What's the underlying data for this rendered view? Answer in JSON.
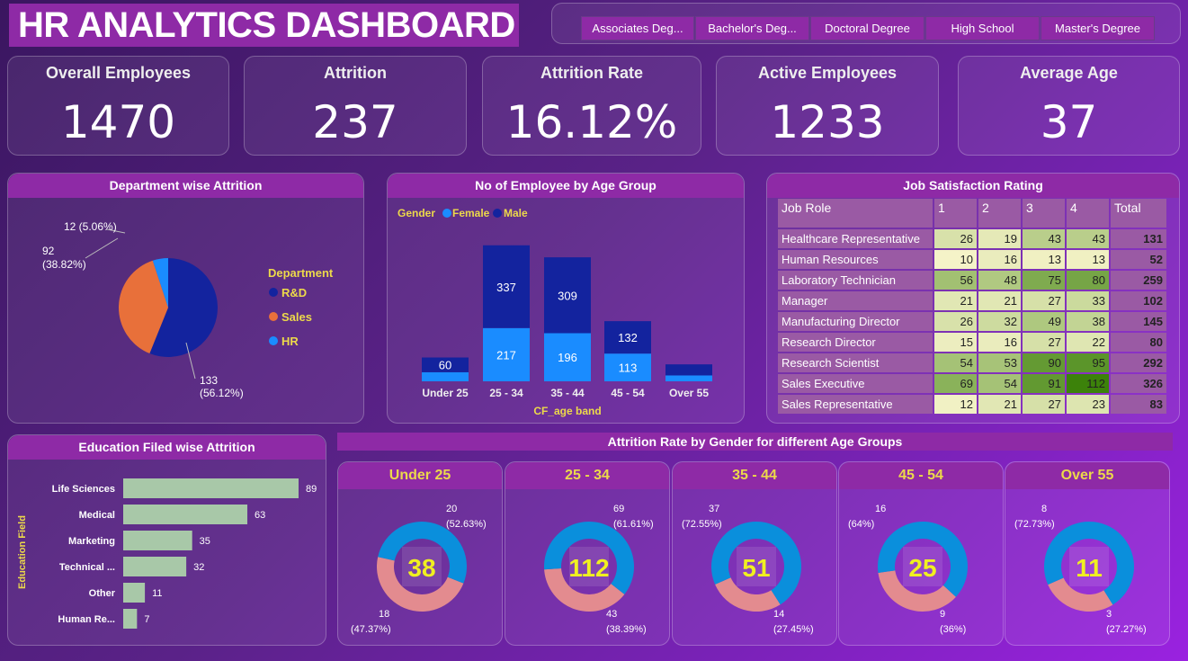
{
  "header": {
    "title": "HR ANALYTICS DASHBOARD"
  },
  "slicer": {
    "options": [
      "Associates Deg...",
      "Bachelor's Deg...",
      "Doctoral Degree",
      "High School",
      "Master's Degree"
    ]
  },
  "kpis": [
    {
      "label": "Overall Employees",
      "value": "1470"
    },
    {
      "label": "Attrition",
      "value": "237"
    },
    {
      "label": "Attrition Rate",
      "value": "16.12%"
    },
    {
      "label": "Active Employees",
      "value": "1233"
    },
    {
      "label": "Average Age",
      "value": "37"
    }
  ],
  "colors": {
    "title_bg": "#8e2aa6",
    "accent_yellow": "#ecd94a",
    "male": "#13239e",
    "female": "#1a8cff",
    "donut_a": "#0a8fdc",
    "donut_b": "#e38b8f",
    "edu_bar": "#a8c8a8"
  },
  "chart_data": [
    {
      "type": "pie",
      "title": "Department wise Attrition",
      "legend_title": "Department",
      "legend_position": "right",
      "slices": [
        {
          "name": "R&D",
          "value": 133,
          "label": "133\n(56.12%)",
          "color": "#13239e"
        },
        {
          "name": "Sales",
          "value": 92,
          "label": "92\n(38.82%)",
          "color": "#e8703a"
        },
        {
          "name": "HR",
          "value": 12,
          "label": "12 (5.06%)",
          "color": "#1a8cff"
        }
      ]
    },
    {
      "type": "bar",
      "stacked": true,
      "title": "No of Employee by Age Group",
      "legend_title": "Gender",
      "legend_position": "top-left",
      "xlabel": "CF_age band",
      "categories": [
        "Under 25",
        "25 - 34",
        "35 - 44",
        "45 - 54",
        "Over 55"
      ],
      "series": [
        {
          "name": "Female",
          "values": [
            37,
            217,
            196,
            113,
            24
          ],
          "labels": [
            "",
            "217",
            "196",
            "113",
            ""
          ]
        },
        {
          "name": "Male",
          "values": [
            60,
            337,
            309,
            132,
            45
          ],
          "labels": [
            "60",
            "337",
            "309",
            "132",
            ""
          ]
        }
      ]
    },
    {
      "type": "table",
      "title": "Job Satisfaction Rating",
      "columns": [
        "Job Role",
        "1",
        "2",
        "3",
        "4",
        "Total"
      ],
      "rows": [
        [
          "Healthcare Representative",
          26,
          19,
          43,
          43,
          131
        ],
        [
          "Human Resources",
          10,
          16,
          13,
          13,
          52
        ],
        [
          "Laboratory Technician",
          56,
          48,
          75,
          80,
          259
        ],
        [
          "Manager",
          21,
          21,
          27,
          33,
          102
        ],
        [
          "Manufacturing Director",
          26,
          32,
          49,
          38,
          145
        ],
        [
          "Research Director",
          15,
          16,
          27,
          22,
          80
        ],
        [
          "Research Scientist",
          54,
          53,
          90,
          95,
          292
        ],
        [
          "Sales Executive",
          69,
          54,
          91,
          112,
          326
        ],
        [
          "Sales Representative",
          12,
          21,
          27,
          23,
          83
        ]
      ]
    },
    {
      "type": "bar",
      "orientation": "horizontal",
      "title": "Education Filed wise Attrition",
      "ylabel": "Education Field",
      "categories": [
        "Life Sciences",
        "Medical",
        "Marketing",
        "Technical ...",
        "Other",
        "Human Re..."
      ],
      "values": [
        89,
        63,
        35,
        32,
        11,
        7
      ]
    },
    {
      "type": "pie",
      "donut": true,
      "title": "Attrition Rate by Gender for different Age Groups",
      "groups": [
        {
          "name": "Under 25",
          "total": "38",
          "slices": [
            {
              "value": 20,
              "label": [
                "20",
                "(52.63%)"
              ]
            },
            {
              "value": 18,
              "label": [
                "18",
                "(47.37%)"
              ]
            }
          ]
        },
        {
          "name": "25 - 34",
          "total": "112",
          "slices": [
            {
              "value": 69,
              "label": [
                "69",
                "(61.61%)"
              ]
            },
            {
              "value": 43,
              "label": [
                "43",
                "(38.39%)"
              ]
            }
          ]
        },
        {
          "name": "35 - 44",
          "total": "51",
          "slices": [
            {
              "value": 37,
              "label": [
                "37",
                "(72.55%)"
              ]
            },
            {
              "value": 14,
              "label": [
                "14",
                "(27.45%)"
              ]
            }
          ]
        },
        {
          "name": "45 - 54",
          "total": "25",
          "slices": [
            {
              "value": 16,
              "label": [
                "16",
                "(64%)"
              ]
            },
            {
              "value": 9,
              "label": [
                "9",
                "(36%)"
              ]
            }
          ]
        },
        {
          "name": "Over 55",
          "total": "11",
          "slices": [
            {
              "value": 8,
              "label": [
                "8",
                "(72.73%)"
              ]
            },
            {
              "value": 3,
              "label": [
                "3",
                "(27.27%)"
              ]
            }
          ]
        }
      ]
    }
  ]
}
